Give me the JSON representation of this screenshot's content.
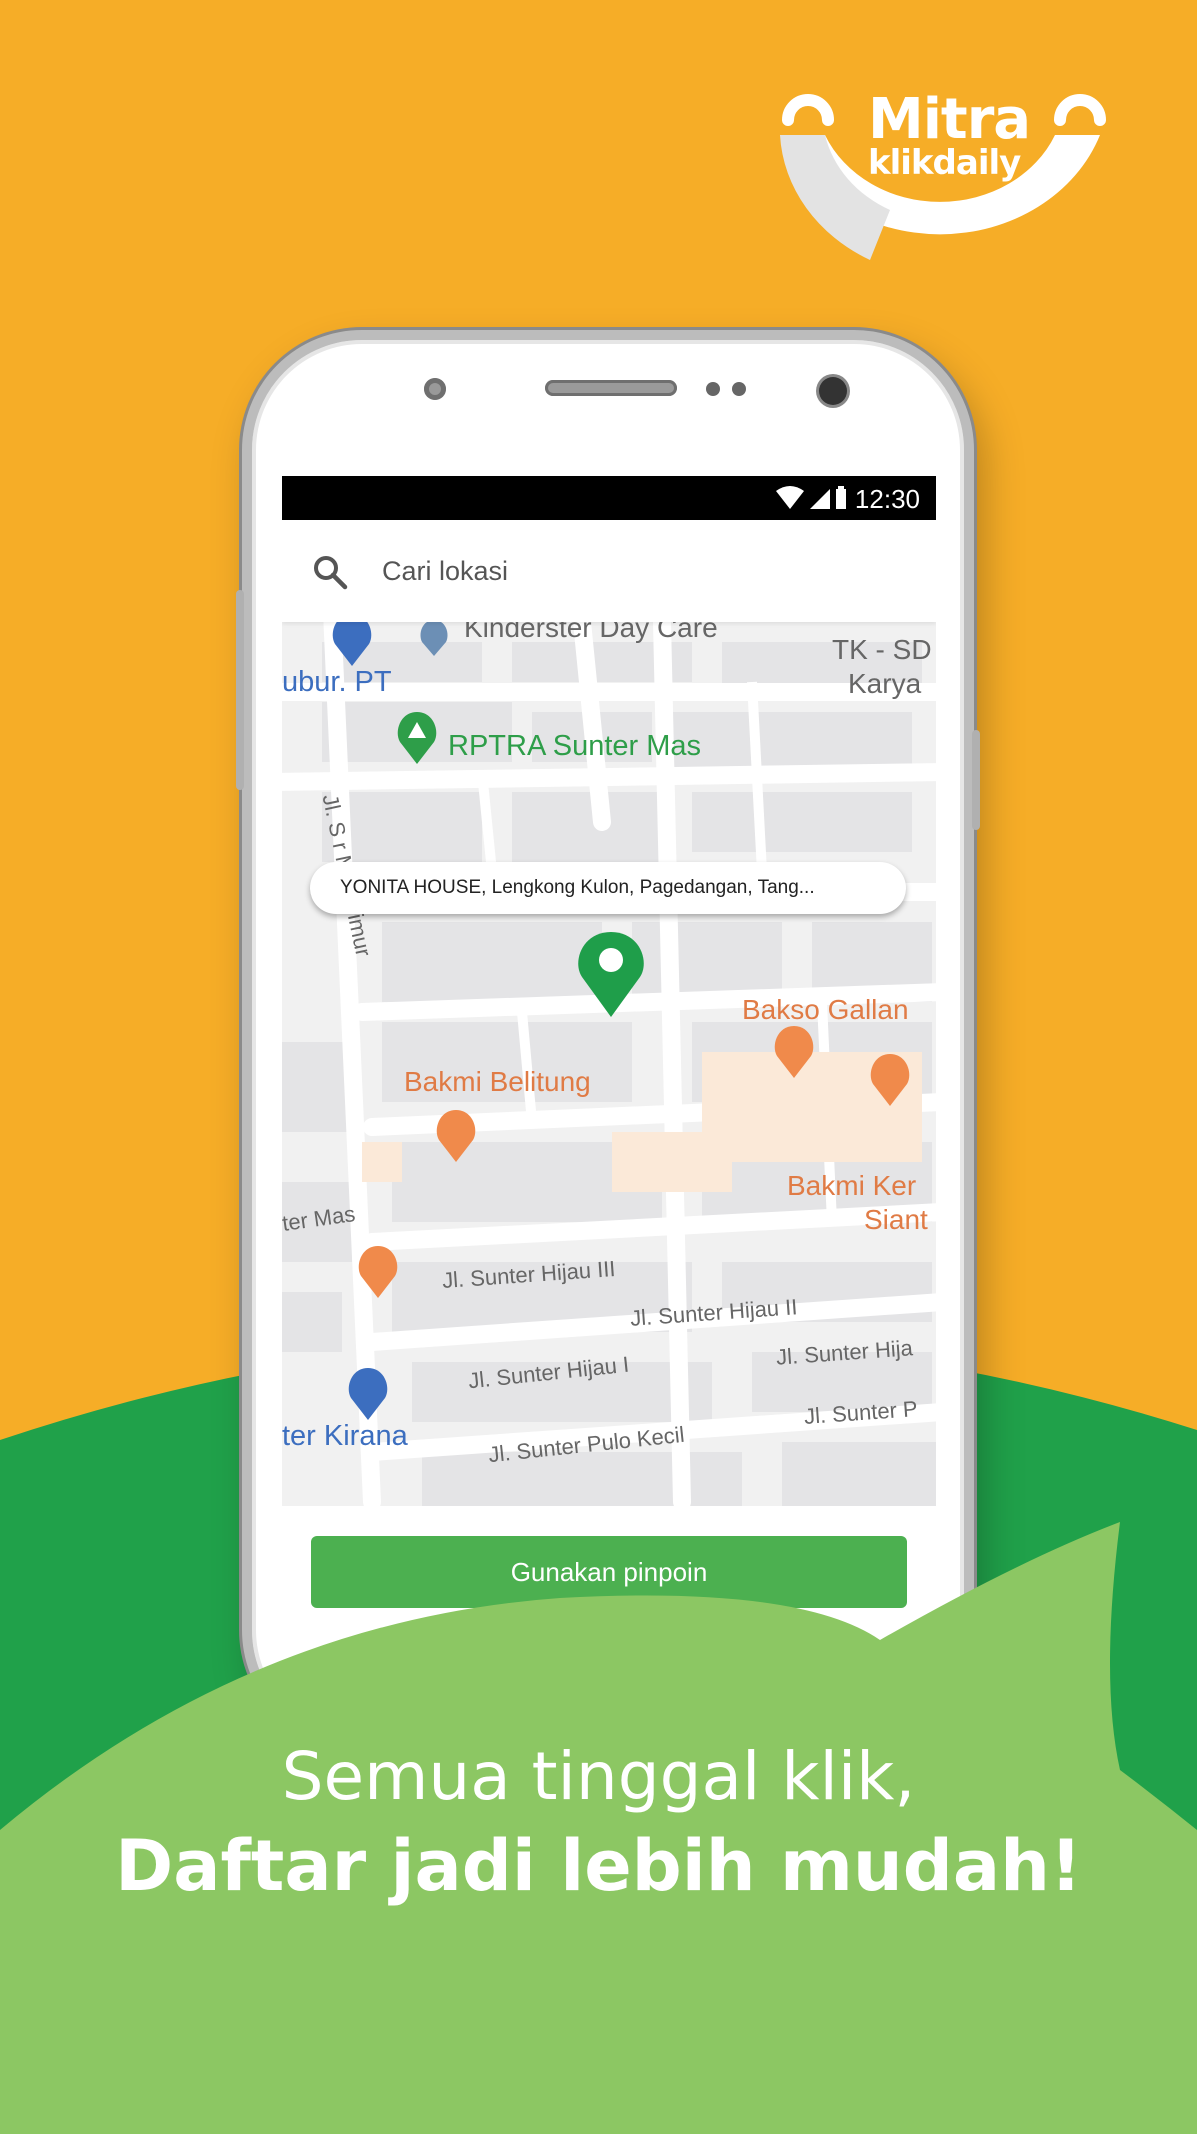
{
  "brand": {
    "logo_line1": "Mitra",
    "logo_line2": "klikdaily",
    "orange": "#F6AD27",
    "green_dark": "#20A14A",
    "green_light": "#8CC763"
  },
  "status_bar": {
    "time": "12:30",
    "icons": [
      "wifi-icon",
      "signal-icon",
      "battery-icon"
    ]
  },
  "search": {
    "placeholder": "Cari lokasi",
    "icon": "search-icon"
  },
  "map": {
    "address_bubble": "YONITA HOUSE, Lengkong Kulon, Pagedangan, Tang...",
    "places": {
      "kinderster": "Kinderster Day Care",
      "tk_sd": "TK - SD",
      "karya": "Karya",
      "ubur": "ubur. PT",
      "rptra": "RPTRA Sunter Mas",
      "bakso": "Bakso Gallan",
      "bakmi_belitung": "Bakmi Belitung",
      "bakmi_ker": "Bakmi Ker",
      "siant": "Siant",
      "kirana": "ter Kirana"
    },
    "roads": {
      "sunter_mas_timur": "Jl. S   r Mas Timur",
      "ter_mas": "ter Mas",
      "hijau_iii": "Jl. Sunter Hijau III",
      "hijau_ii": "Jl. Sunter Hijau II",
      "hijau_right": "Jl. Sunter Hija",
      "hijau_i": "Jl. Sunter Hijau I",
      "pulo_kecil": "Jl. Sunter Pulo Kecil",
      "sunter_p": "Jl. Sunter P"
    }
  },
  "action": {
    "button_label": "Gunakan pinpoin"
  },
  "tagline": {
    "line1": "Semua tinggal klik,",
    "line2": "Daftar jadi lebih mudah!"
  }
}
